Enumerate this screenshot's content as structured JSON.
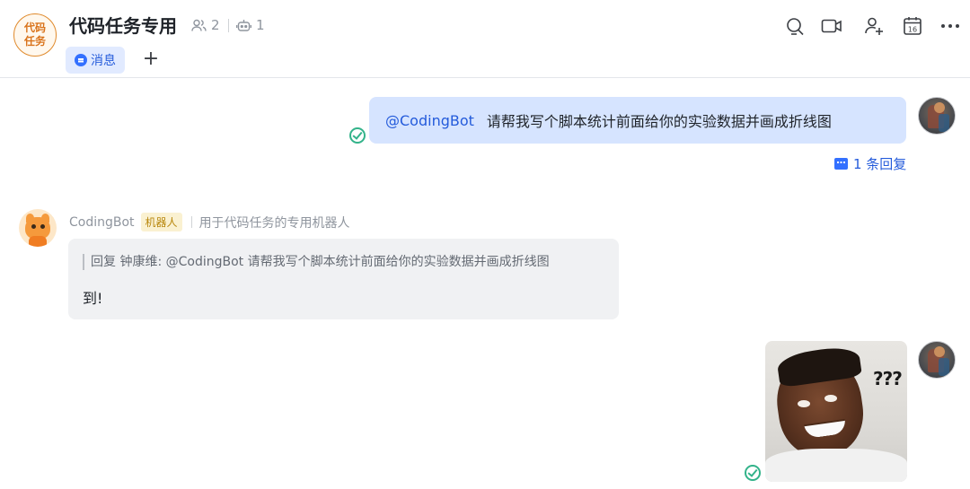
{
  "header": {
    "group_avatar_line1": "代码",
    "group_avatar_line2": "任务",
    "title": "代码任务专用",
    "member_count": "2",
    "bot_count": "1",
    "tabs": [
      {
        "label": "消息",
        "active": true
      }
    ],
    "add_tab": "+"
  },
  "toolbar": [
    {
      "name": "search-icon"
    },
    {
      "name": "video-call-icon"
    },
    {
      "name": "add-member-icon"
    },
    {
      "name": "calendar-icon",
      "text": "16"
    },
    {
      "name": "more-icon"
    }
  ],
  "messages": {
    "user_message": {
      "mention": "@CodingBot",
      "text": "请帮我写个脚本统计前面给你的实验数据并画成折线图",
      "reply_count_label": "1 条回复"
    },
    "bot_message": {
      "sender": "CodingBot",
      "tag": "机器人",
      "description": "用于代码任务的专用机器人",
      "quote": "回复 钟康维: @CodingBot 请帮我写个脚本统计前面给你的实验数据并画成折线图",
      "text": "到!"
    },
    "sticker_message": {
      "sticker_text": "???"
    }
  },
  "colors": {
    "accent": "#3370ff",
    "user_bubble": "#d6e4ff",
    "bot_bubble": "#f0f1f3",
    "read_check": "#33b38a",
    "group_avatar": "#e08a2c"
  }
}
